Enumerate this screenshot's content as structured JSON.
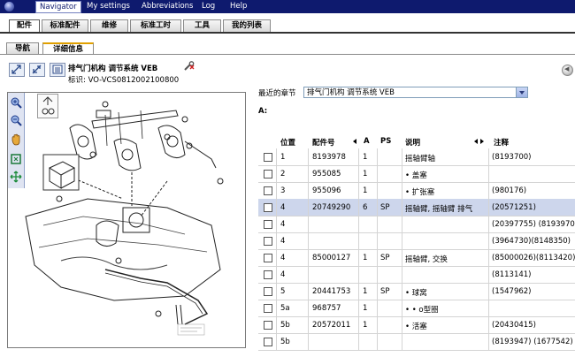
{
  "menubar": {
    "items": [
      {
        "label": "Navigator",
        "active": true
      },
      {
        "label": "My settings",
        "active": false
      },
      {
        "label": "Abbreviations",
        "active": false
      },
      {
        "label": "Log",
        "active": false
      },
      {
        "label": "Help",
        "active": false
      }
    ]
  },
  "main_tabs": [
    {
      "label": "配件",
      "active": true
    },
    {
      "label": "标准配件",
      "active": false
    },
    {
      "label": "维修",
      "active": false
    },
    {
      "label": "标准工时",
      "active": false
    },
    {
      "label": "工具",
      "active": false
    },
    {
      "label": "我的列表",
      "active": false
    }
  ],
  "sub_tabs": [
    {
      "label": "导航",
      "active": false
    },
    {
      "label": "详细信息",
      "active": true
    }
  ],
  "header": {
    "title": "排气门机构  调节系统  VEB",
    "id_text": "标识: VO-VCS0812002100800"
  },
  "chapter": {
    "label": "最近的章节",
    "selected": "排气门机构 调节系统 VEB"
  },
  "section_label": "A:",
  "table": {
    "columns": [
      "位置",
      "配件号",
      "A",
      "PS",
      "说明",
      "注释"
    ],
    "rows": [
      {
        "pos": "1",
        "part": "8193978",
        "a": "1",
        "ps": "",
        "desc": "摇轴臂轴",
        "note": "(8193700)",
        "highlight": false
      },
      {
        "pos": "2",
        "part": "955085",
        "a": "1",
        "ps": "",
        "desc": "• 盖塞",
        "note": "",
        "highlight": false
      },
      {
        "pos": "3",
        "part": "955096",
        "a": "1",
        "ps": "",
        "desc": "• 扩张塞",
        "note": "(980176)",
        "highlight": false
      },
      {
        "pos": "4",
        "part": "20749290",
        "a": "6",
        "ps": "SP",
        "desc": "摇轴臂, 摇轴臂 排气",
        "note": "(20571251)",
        "highlight": true
      },
      {
        "pos": "4",
        "part": "",
        "a": "",
        "ps": "",
        "desc": "",
        "note": "(20397755) (8193970)",
        "highlight": false
      },
      {
        "pos": "4",
        "part": "",
        "a": "",
        "ps": "",
        "desc": "",
        "note": "(3964730)(8148350)",
        "highlight": false
      },
      {
        "pos": "4",
        "part": "85000127",
        "a": "1",
        "ps": "SP",
        "desc": "摇轴臂, 交换",
        "note": "(85000026)(8113420)",
        "highlight": false
      },
      {
        "pos": "4",
        "part": "",
        "a": "",
        "ps": "",
        "desc": "",
        "note": "(8113141)",
        "highlight": false
      },
      {
        "pos": "5",
        "part": "20441753",
        "a": "1",
        "ps": "SP",
        "desc": "• 球窝",
        "note": "(1547962)",
        "highlight": false
      },
      {
        "pos": "5a",
        "part": "968757",
        "a": "1",
        "ps": "",
        "desc": "• • o型圈",
        "note": "",
        "highlight": false
      },
      {
        "pos": "5b",
        "part": "20572011",
        "a": "1",
        "ps": "",
        "desc": "• 活塞",
        "note": "(20430415)",
        "highlight": false
      },
      {
        "pos": "5b",
        "part": "",
        "a": "",
        "ps": "",
        "desc": "",
        "note": "(8193947) (1677542)",
        "highlight": false
      }
    ]
  },
  "colors": {
    "menubar_bg": "#0e1a6e",
    "highlight_row": "#cdd6ec",
    "active_subtab_accent": "#e0a000"
  },
  "icons": [
    "zoom-in-icon",
    "zoom-out-icon",
    "pan-hand-icon",
    "fit-icon",
    "move-icon",
    "wrench-icon"
  ]
}
